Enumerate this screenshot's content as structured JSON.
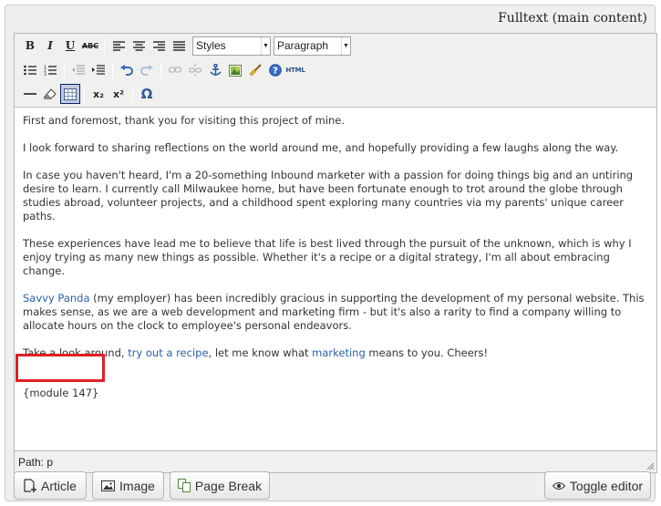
{
  "field": {
    "label": "Fulltext (main content)"
  },
  "toolbar": {
    "bold": "B",
    "italic": "I",
    "underline": "U",
    "strike": "ABC",
    "styles_select": {
      "value": "Styles"
    },
    "format_select": {
      "value": "Paragraph"
    },
    "html": "HTML",
    "subscript": "x₂",
    "superscript": "x²",
    "special_char": "Ω"
  },
  "content": {
    "p1": "First and foremost, thank you for visiting this project of mine.",
    "p2": "I look forward to sharing reflections on the world around me, and hopefully providing a few laughs along the way.",
    "p3": "In case you haven't heard, I'm a 20-something Inbound marketer with a passion for doing things big and an untiring desire to learn. I currently call Milwaukee home, but have been fortunate enough to trot around the globe through studies abroad, volunteer projects, and a childhood spent exploring many countries via my parents' unique career paths.",
    "p4": "These experiences have lead me to believe that life is best lived through the pursuit of the unknown, which is why I enjoy trying as many new things as possible. Whether it's a recipe or a digital strategy, I'm all about embracing change.",
    "p5_link": "Savvy Panda",
    "p5_rest": " (my employer) has been incredibly gracious in supporting the development of my personal website. This makes sense, as we are a web development and marketing firm - but it's also a rarity to find a company willing to allocate hours on the clock to employee's personal endeavors.",
    "p6_a": "Take a look around, ",
    "p6_link1": "try out a recipe",
    "p6_b": ", let me know what ",
    "p6_link2": "marketing",
    "p6_c": " means to you. Cheers!",
    "module": "{module 147}"
  },
  "statusbar": {
    "path": "Path: p"
  },
  "buttons": {
    "article": "Article",
    "image": "Image",
    "page_break": "Page Break",
    "toggle_editor": "Toggle editor"
  },
  "colors": {
    "link": "#2a62a8",
    "highlight_box": "#e01f26",
    "active_button": "#c2cbe0"
  }
}
